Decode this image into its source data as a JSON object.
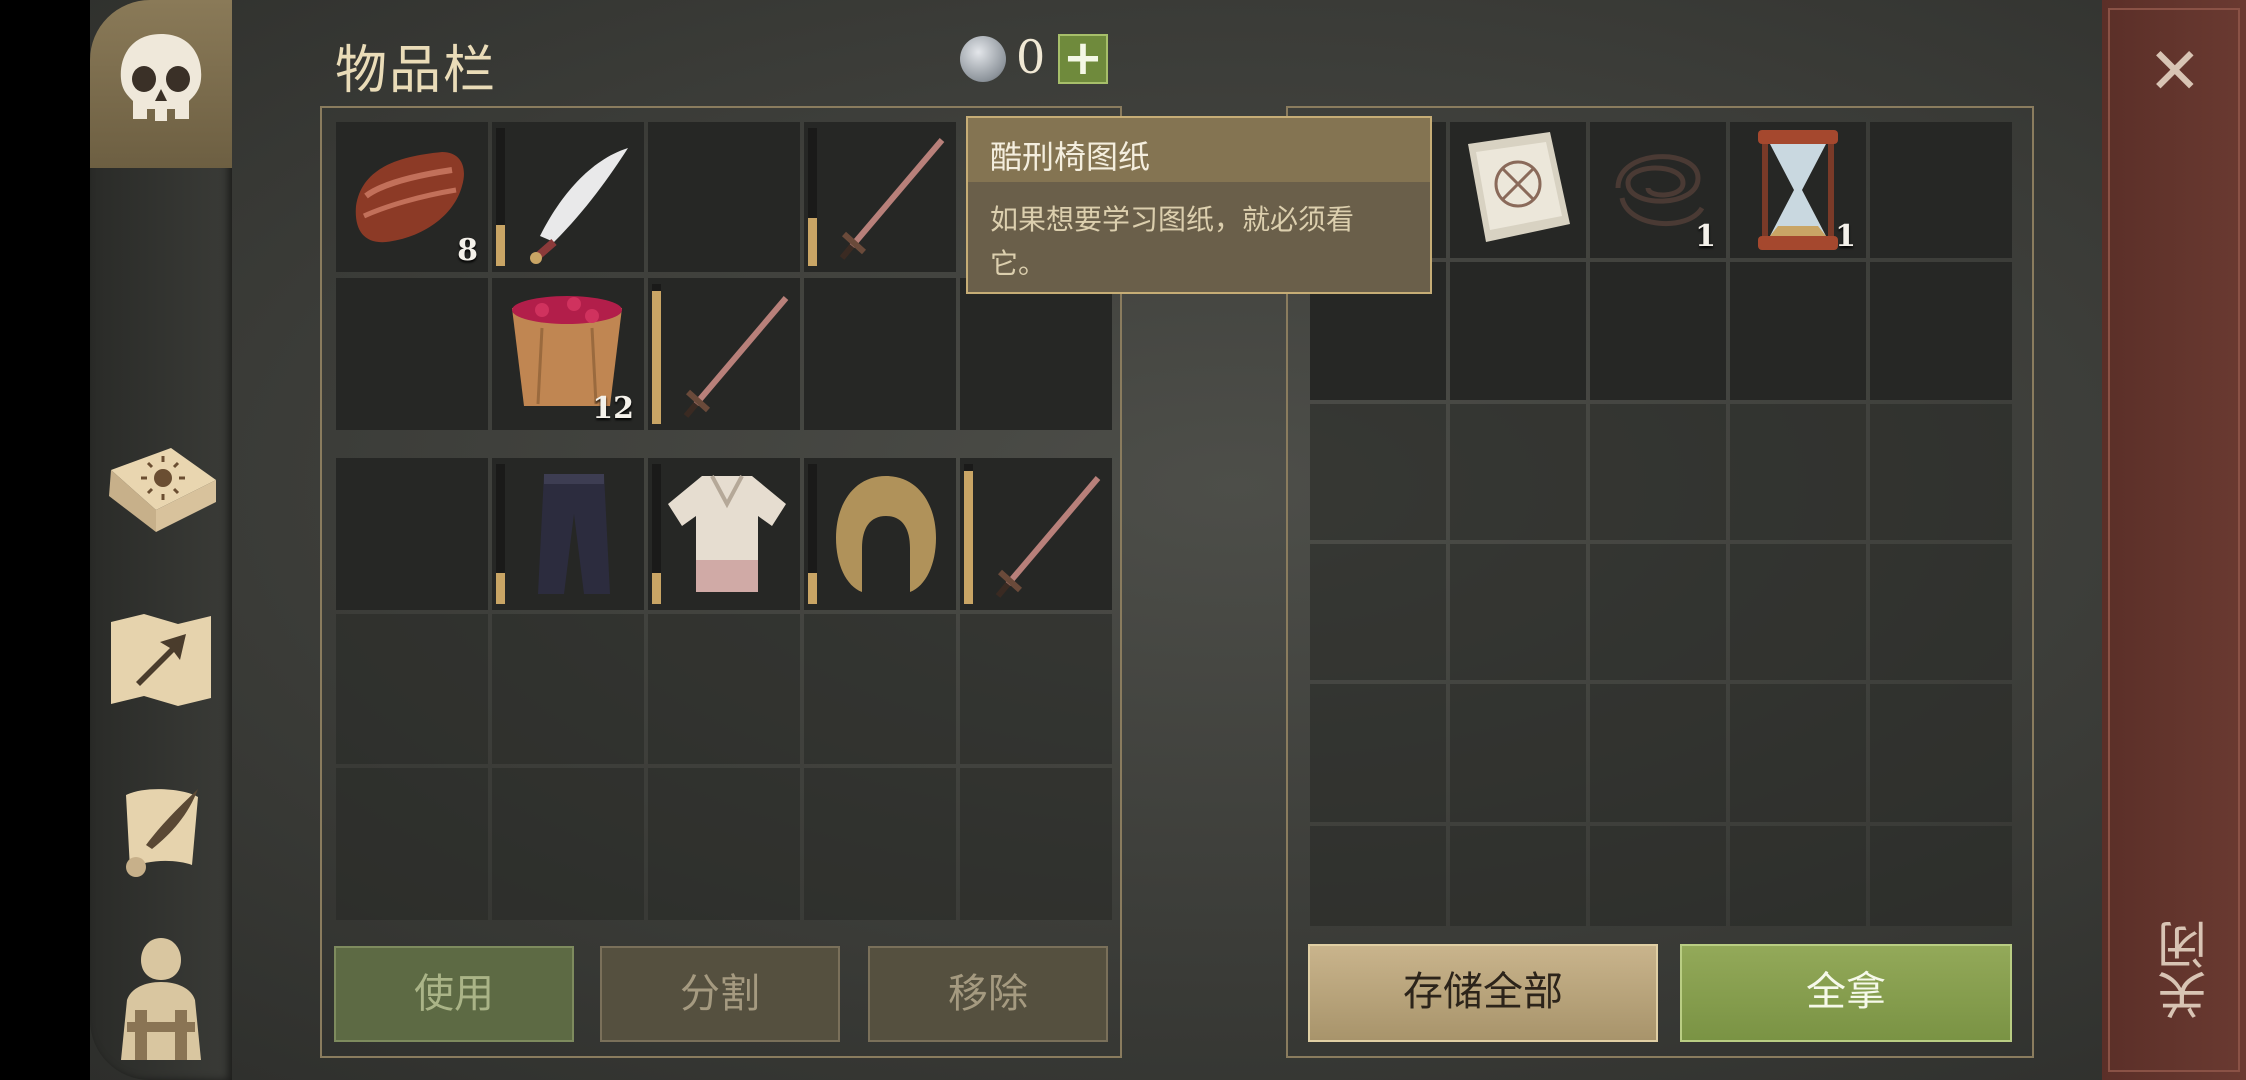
{
  "header": {
    "title": "物品栏",
    "currency_count": "0",
    "plus_label": "+"
  },
  "icons": {
    "rail": [
      "skull-icon",
      "sun-book-icon",
      "map-arrow-icon",
      "scroll-quill-icon",
      "character-outfit-icon"
    ],
    "close": "close-icon",
    "coin": "silver-coin-icon"
  },
  "inventory": {
    "row1": [
      {
        "item": "meat-slab-icon",
        "qty": "8"
      },
      {
        "item": "scimitar-icon",
        "durability": 0.3
      },
      {
        "item": ""
      },
      {
        "item": "sword-icon",
        "durability": 0.35
      }
    ],
    "row2": [
      {
        "item": ""
      },
      {
        "item": "berry-bucket-icon",
        "qty": "12"
      },
      {
        "item": "sword-icon",
        "durability": 0.95
      },
      {
        "item": ""
      },
      {
        "item": ""
      }
    ],
    "equipment": [
      {
        "item": ""
      },
      {
        "item": "trousers-icon",
        "durability": 0.22
      },
      {
        "item": "shirt-icon",
        "durability": 0.22
      },
      {
        "item": "hood-icon",
        "durability": 0.22
      },
      {
        "item": "sword-icon",
        "durability": 0.95
      }
    ]
  },
  "tooltip": {
    "title": "酷刑椅图纸",
    "body": "如果想要学习图纸，就必须看它。"
  },
  "container": {
    "row1": [
      {
        "item": "blueprint-scroll-icon"
      },
      {
        "item": "rope-icon",
        "qty": "1"
      },
      {
        "item": "hourglass-icon",
        "qty": "1"
      },
      {
        "item": ""
      }
    ]
  },
  "buttons": {
    "use": "使用",
    "split": "分割",
    "remove": "移除",
    "store_all": "存储全部",
    "take_all": "全拿",
    "close_label": "关闭"
  },
  "colors": {
    "accent_green": "#7a9344",
    "panel_border": "#8a7c5e",
    "durability": "#c9a565",
    "close_bg": "#5b2f28"
  }
}
